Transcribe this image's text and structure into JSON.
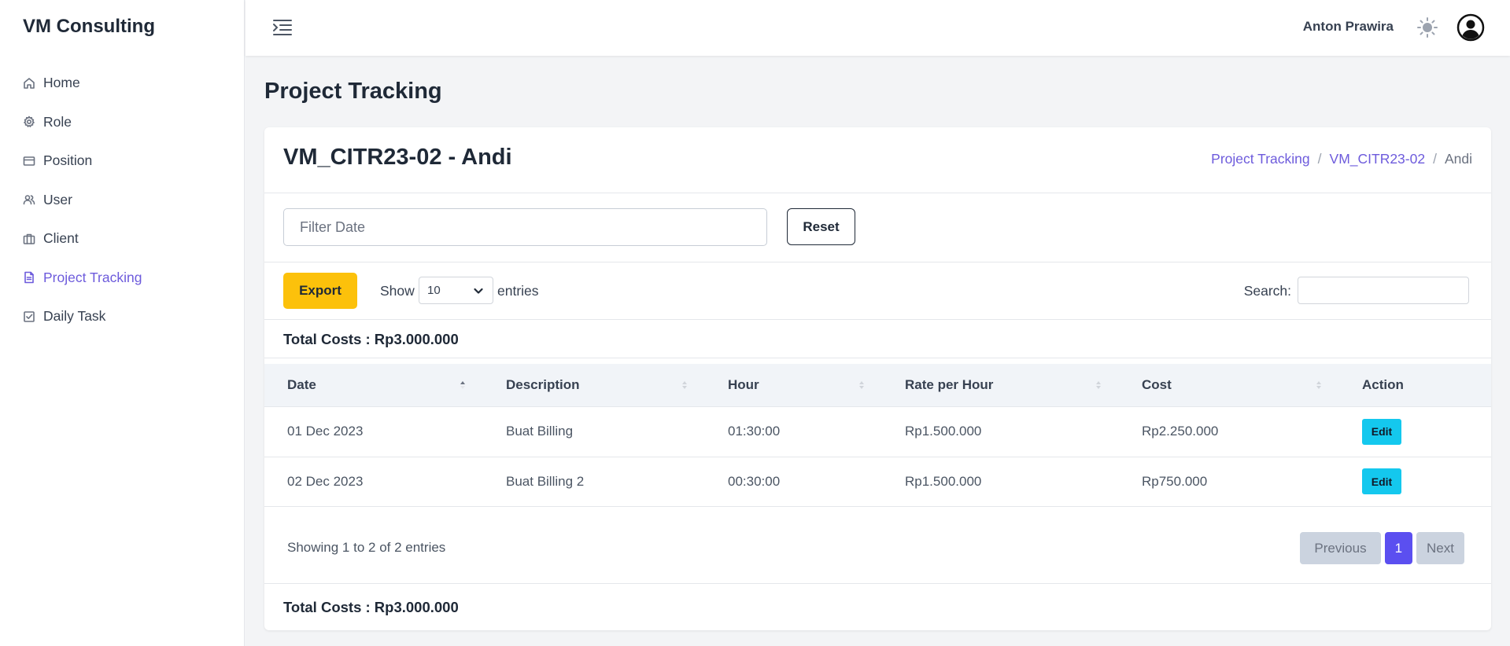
{
  "brand": "VM Consulting",
  "sidebar": {
    "items": [
      {
        "label": "Home",
        "icon": "home-icon"
      },
      {
        "label": "Role",
        "icon": "gear-icon"
      },
      {
        "label": "Position",
        "icon": "card-icon"
      },
      {
        "label": "User",
        "icon": "users-icon"
      },
      {
        "label": "Client",
        "icon": "briefcase-icon"
      },
      {
        "label": "Project Tracking",
        "icon": "document-icon",
        "active": true
      },
      {
        "label": "Daily Task",
        "icon": "checkbox-icon"
      }
    ]
  },
  "header": {
    "user_name": "Anton Prawira"
  },
  "page_title": "Project Tracking",
  "card": {
    "title": "VM_CITR23-02 - Andi",
    "breadcrumb": [
      "Project Tracking",
      "VM_CITR23-02",
      "Andi"
    ],
    "breadcrumb_sep": "/"
  },
  "filter": {
    "placeholder": "Filter Date",
    "reset_label": "Reset"
  },
  "toolbar": {
    "export_label": "Export",
    "show_label": "Show",
    "entries_value": "10",
    "entries_label": "entries",
    "search_label": "Search:"
  },
  "total_costs": "Total Costs : Rp3.000.000",
  "table": {
    "headers": [
      "Date",
      "Description",
      "Hour",
      "Rate per Hour",
      "Cost",
      "Action"
    ],
    "rows": [
      {
        "date": "01 Dec 2023",
        "description": "Buat Billing",
        "hour": "01:30:00",
        "rate": "Rp1.500.000",
        "cost": "Rp2.250.000",
        "action": "Edit"
      },
      {
        "date": "02 Dec 2023",
        "description": "Buat Billing 2",
        "hour": "00:30:00",
        "rate": "Rp1.500.000",
        "cost": "Rp750.000",
        "action": "Edit"
      }
    ]
  },
  "pagination": {
    "info": "Showing 1 to 2 of 2 entries",
    "previous": "Previous",
    "current": "1",
    "next": "Next"
  },
  "colors": {
    "accent": "#6d5bdc",
    "export": "#fcc10b",
    "edit": "#14c8ee",
    "page_active": "#5b4ff0"
  }
}
